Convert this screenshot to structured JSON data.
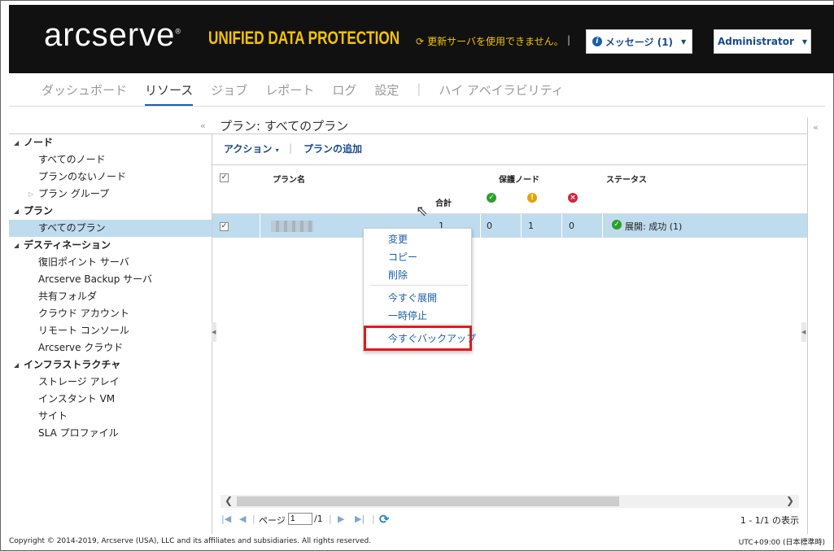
{
  "header": {
    "logo": "arcserve",
    "logo_reg": "®",
    "tagline": "UNIFIED DATA PROTECTION",
    "update_notice": "更新サーバを使用できません。",
    "messages_button": "メッセージ (1)",
    "user_button": "Administrator"
  },
  "nav": {
    "tabs": [
      {
        "label": "ダッシュボード"
      },
      {
        "label": "リソース"
      },
      {
        "label": "ジョブ"
      },
      {
        "label": "レポート"
      },
      {
        "label": "ログ"
      },
      {
        "label": "設定"
      },
      {
        "label": "ハイ アベイラビリティ"
      }
    ],
    "active_tab": "リソース"
  },
  "sidebar": {
    "items": [
      {
        "label": "ノード",
        "type": "group"
      },
      {
        "label": "すべてのノード",
        "type": "item"
      },
      {
        "label": "プランのないノード",
        "type": "item"
      },
      {
        "label": "プラン グループ",
        "type": "subgroup"
      },
      {
        "label": "プラン",
        "type": "group"
      },
      {
        "label": "すべてのプラン",
        "type": "item",
        "selected": true
      },
      {
        "label": "デスティネーション",
        "type": "group"
      },
      {
        "label": "復旧ポイント サーバ",
        "type": "item"
      },
      {
        "label": "Arcserve Backup サーバ",
        "type": "item"
      },
      {
        "label": "共有フォルダ",
        "type": "item"
      },
      {
        "label": "クラウド アカウント",
        "type": "item"
      },
      {
        "label": "リモート コンソール",
        "type": "item"
      },
      {
        "label": "Arcserve クラウド",
        "type": "item"
      },
      {
        "label": "インフラストラクチャ",
        "type": "group"
      },
      {
        "label": "ストレージ アレイ",
        "type": "item"
      },
      {
        "label": "インスタント VM",
        "type": "item"
      },
      {
        "label": "サイト",
        "type": "item"
      },
      {
        "label": "SLA プロファイル",
        "type": "item"
      }
    ]
  },
  "main": {
    "title": "プラン: すべてのプラン",
    "toolbar": {
      "actions_label": "アクション",
      "add_plan_label": "プランの追加"
    },
    "grid": {
      "col_plan_name": "プラン名",
      "col_protected_nodes": "保護ノード",
      "col_status": "ステータス",
      "col_total": "合計",
      "rows": [
        {
          "total": "1",
          "ok": "0",
          "warn": "1",
          "err": "0",
          "status": "展開: 成功 (1)"
        }
      ]
    },
    "context_menu": {
      "items": [
        "変更",
        "コピー",
        "削除",
        "今すぐ展開",
        "一時停止",
        "今すぐバックアップ"
      ]
    },
    "pager": {
      "page_label": "ページ",
      "page_value": "1",
      "page_total": "/1",
      "display_info": "1 - 1/1 の表示"
    }
  },
  "footer": {
    "copyright": "Copyright © 2014-2019, Arcserve (USA), LLC and its affiliates and subsidiaries. All rights reserved.",
    "timezone": "UTC+09:00 (日本標準時)"
  },
  "colors": {
    "header_bg": "#111111",
    "brand_yellow": "#f2c300",
    "link_blue": "#1a4a8a",
    "selection": "#bfdcef",
    "highlight_red": "#e01b1b"
  }
}
